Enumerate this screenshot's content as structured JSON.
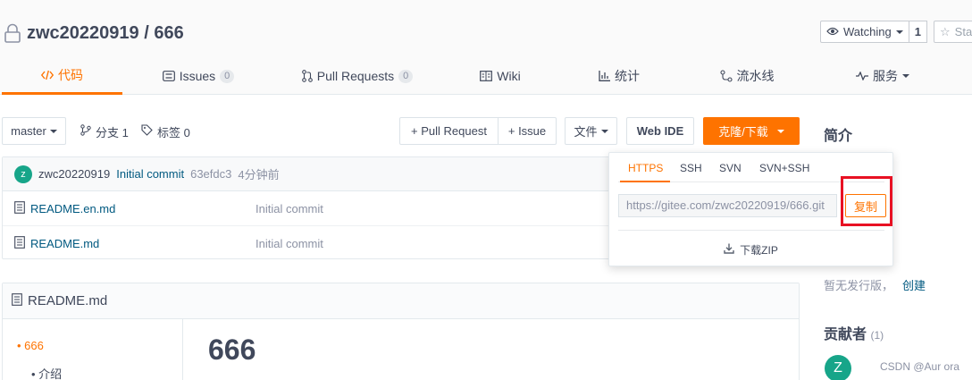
{
  "repo": {
    "title": "zwc20220919 / 666",
    "watch_label": "Watching",
    "watch_count": "1",
    "star_label": "Sta"
  },
  "tabs": [
    {
      "label": "代码",
      "icon": "code-icon",
      "active": true
    },
    {
      "label": "Issues",
      "badge": "0",
      "icon": "issues-icon"
    },
    {
      "label": "Pull Requests",
      "badge": "0",
      "icon": "pull-request-icon"
    },
    {
      "label": "Wiki",
      "icon": "wiki-icon"
    },
    {
      "label": "统计",
      "icon": "stats-icon"
    },
    {
      "label": "流水线",
      "icon": "pipeline-icon"
    },
    {
      "label": "服务",
      "icon": "service-icon"
    }
  ],
  "toolbar": {
    "branch": "master",
    "branches_label": "分支 1",
    "tags_label": "标签 0",
    "pull_request_label": "+ Pull Request",
    "issue_label": "+ Issue",
    "file_label": "文件",
    "web_ide_label": "Web IDE",
    "clone_label": "克隆/下载"
  },
  "commit": {
    "avatar_letter": "z",
    "author": "zwc20220919",
    "message": "Initial commit",
    "hash": "63efdc3",
    "time": "4分钟前"
  },
  "files": [
    {
      "name": "README.en.md",
      "message": "Initial commit"
    },
    {
      "name": "README.md",
      "message": "Initial commit"
    }
  ],
  "readme": {
    "header": "README.md",
    "toc": [
      "666",
      "介绍"
    ],
    "heading": "666"
  },
  "clone": {
    "protocols": [
      "HTTPS",
      "SSH",
      "SVN",
      "SVN+SSH"
    ],
    "url": "https://gitee.com/zwc20220919/666.git",
    "copy_label": "复制",
    "download_zip_label": "下载ZIP"
  },
  "sidebar": {
    "intro_title": "简介",
    "no_release_text": "暂无发行版，",
    "create_link": "创建",
    "contributors_title": "贡献者",
    "contributors_count": "(1)",
    "contributor_avatar_letter": "Z"
  },
  "watermark": "CSDN @Aur ora",
  "colors": {
    "accent": "#fe7300",
    "link": "#005980",
    "highlight_box": "#e81123"
  }
}
